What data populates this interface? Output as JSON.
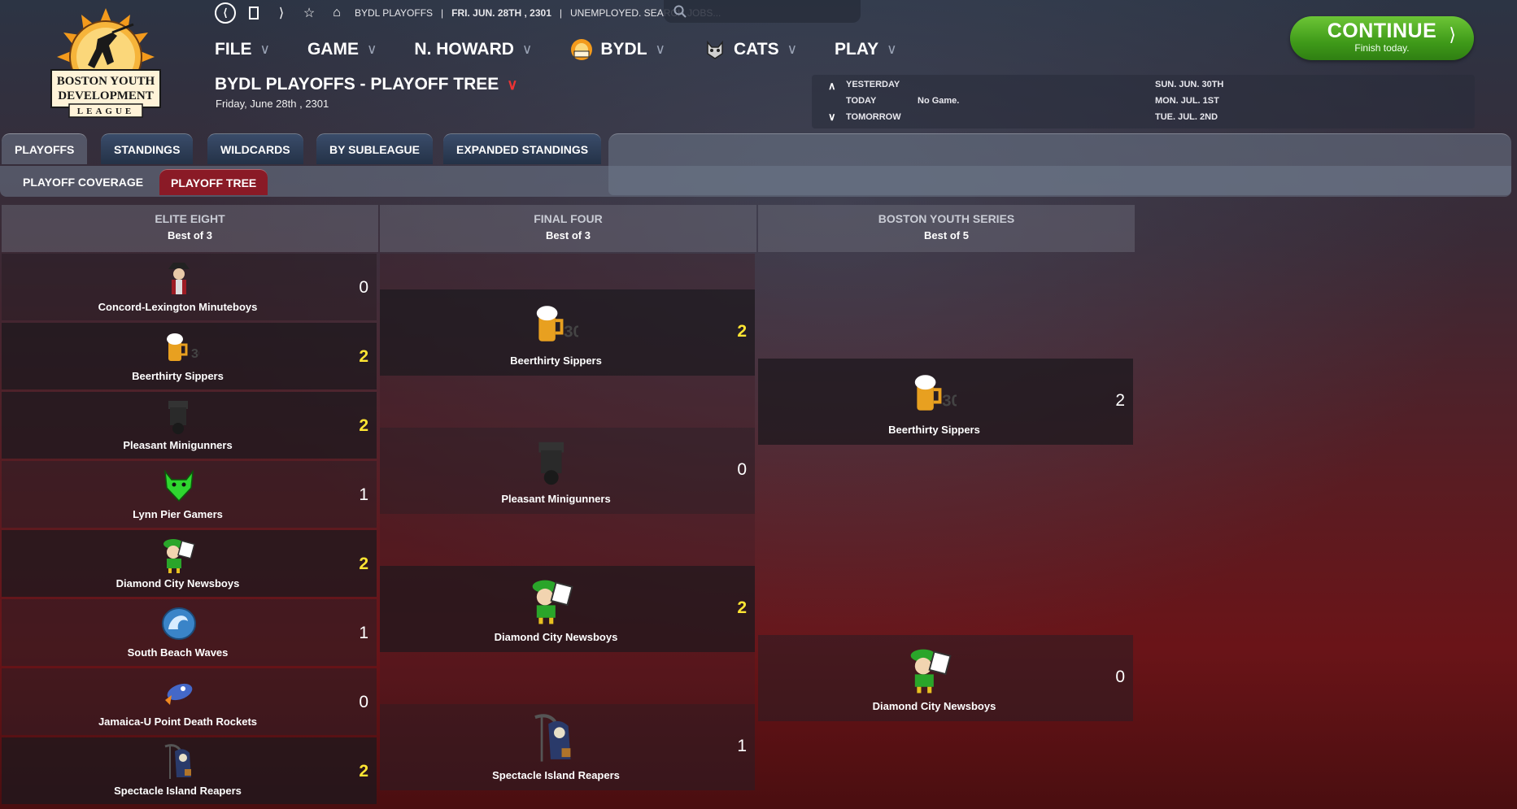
{
  "header": {
    "crumb_1": "BYDL PLAYOFFS",
    "crumb_2": "FRI. JUN. 28TH , 2301",
    "crumb_3": "UNEMPLOYED. SEARCH JOBS...",
    "search_placeholder": "",
    "logo_text_1": "BOSTON YOUTH",
    "logo_text_2": "DEVELOPMENT",
    "logo_text_3": "LEAGUE"
  },
  "menu": {
    "file": "FILE",
    "game": "GAME",
    "manager": "N. HOWARD",
    "league": "BYDL",
    "team": "CATS",
    "play": "PLAY"
  },
  "page": {
    "title": "BYDL PLAYOFFS - PLAYOFF TREE",
    "date": "Friday, June 28th , 2301"
  },
  "calendar": {
    "yesterday_label": "YESTERDAY",
    "today_label": "TODAY",
    "tomorrow_label": "TOMORROW",
    "today_value": "No Game.",
    "r1": "SUN. JUN. 30TH",
    "r2": "MON. JUL. 1ST",
    "r3": "TUE. JUL. 2ND"
  },
  "continue": {
    "label": "CONTINUE",
    "sub": "Finish today."
  },
  "tabs": [
    "PLAYOFFS",
    "STANDINGS",
    "WILDCARDS",
    "BY SUBLEAGUE",
    "EXPANDED STANDINGS"
  ],
  "subtabs": [
    "PLAYOFF COVERAGE",
    "PLAYOFF TREE"
  ],
  "rounds": [
    {
      "name": "ELITE EIGHT",
      "format": "Best of 3"
    },
    {
      "name": "FINAL FOUR",
      "format": "Best of 3"
    },
    {
      "name": "BOSTON YOUTH SERIES",
      "format": "Best of 5"
    }
  ],
  "elite_eight": [
    {
      "team": "Concord-Lexington Minuteboys",
      "score": "0"
    },
    {
      "team": "Beerthirty Sippers",
      "score": "2"
    },
    {
      "team": "Pleasant Minigunners",
      "score": "2"
    },
    {
      "team": "Lynn Pier Gamers",
      "score": "1"
    },
    {
      "team": "Diamond City Newsboys",
      "score": "2"
    },
    {
      "team": "South Beach Waves",
      "score": "1"
    },
    {
      "team": "Jamaica-U Point Death Rockets",
      "score": "0"
    },
    {
      "team": "Spectacle Island Reapers",
      "score": "2"
    }
  ],
  "final_four": [
    {
      "team": "Beerthirty Sippers",
      "score": "2"
    },
    {
      "team": "Pleasant Minigunners",
      "score": "0"
    },
    {
      "team": "Diamond City Newsboys",
      "score": "2"
    },
    {
      "team": "Spectacle Island Reapers",
      "score": "1"
    }
  ],
  "finals": [
    {
      "team": "Beerthirty Sippers",
      "score": "2"
    },
    {
      "team": "Diamond City Newsboys",
      "score": "0"
    }
  ],
  "colors": {
    "accent_red": "#8a1a26",
    "win_yellow": "#ffe533",
    "continue_green": "#4fae22"
  }
}
